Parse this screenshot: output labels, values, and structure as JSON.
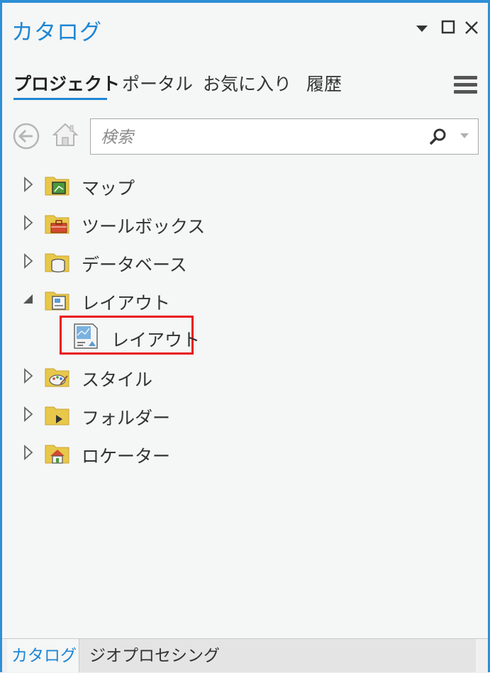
{
  "pane": {
    "title": "カタログ"
  },
  "tabs": [
    {
      "label": "プロジェクト",
      "active": true
    },
    {
      "label": "ポータル",
      "active": false
    },
    {
      "label": "お気に入り",
      "active": false
    },
    {
      "label": "履歴",
      "active": false
    }
  ],
  "search": {
    "placeholder": "検索"
  },
  "tree": {
    "items": [
      {
        "label": "マップ",
        "icon": "map-folder-icon",
        "expanded": false
      },
      {
        "label": "ツールボックス",
        "icon": "toolbox-folder-icon",
        "expanded": false
      },
      {
        "label": "データベース",
        "icon": "database-folder-icon",
        "expanded": false
      },
      {
        "label": "レイアウト",
        "icon": "layout-folder-icon",
        "expanded": true
      },
      {
        "label": "スタイル",
        "icon": "style-folder-icon",
        "expanded": false
      },
      {
        "label": "フォルダー",
        "icon": "folder-connection-icon",
        "expanded": false
      },
      {
        "label": "ロケーター",
        "icon": "locator-folder-icon",
        "expanded": false
      }
    ],
    "layout_child": {
      "label": "レイアウト",
      "icon": "layout-item-icon",
      "highlighted": true
    }
  },
  "bottom_tabs": [
    {
      "label": "カタログ",
      "active": true
    },
    {
      "label": "ジオプロセシング",
      "active": false
    }
  ],
  "colors": {
    "accent": "#1e86d4",
    "highlight_border": "#e8161b",
    "folder": "#e8c84a"
  }
}
